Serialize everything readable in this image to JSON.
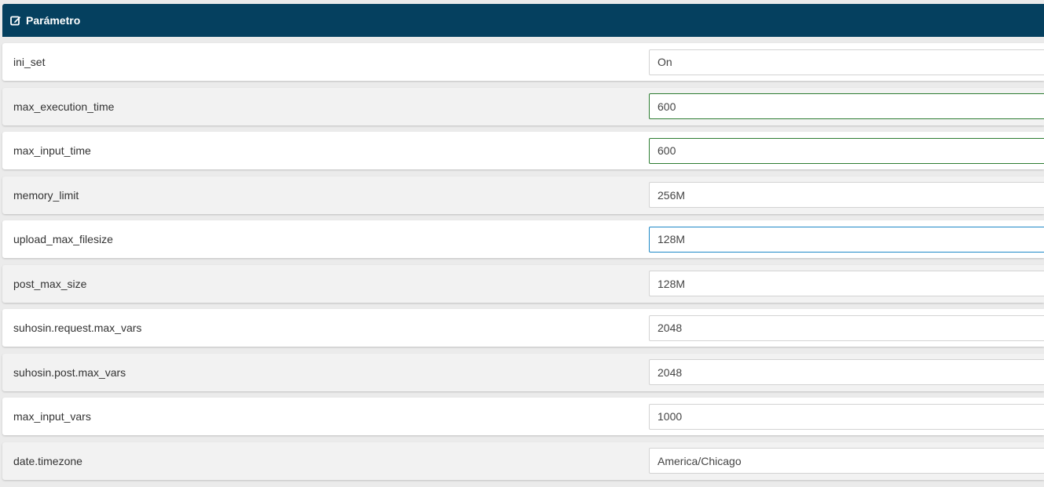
{
  "header": {
    "title": "Parámetro",
    "icon": "edit-icon"
  },
  "rows": [
    {
      "name": "ini_set",
      "value": "On",
      "state": "normal"
    },
    {
      "name": "max_execution_time",
      "value": "600",
      "state": "valid"
    },
    {
      "name": "max_input_time",
      "value": "600",
      "state": "valid"
    },
    {
      "name": "memory_limit",
      "value": "256M",
      "state": "normal"
    },
    {
      "name": "upload_max_filesize",
      "value": "128M",
      "state": "focused"
    },
    {
      "name": "post_max_size",
      "value": "128M",
      "state": "normal"
    },
    {
      "name": "suhosin.request.max_vars",
      "value": "2048",
      "state": "normal"
    },
    {
      "name": "suhosin.post.max_vars",
      "value": "2048",
      "state": "normal"
    },
    {
      "name": "max_input_vars",
      "value": "1000",
      "state": "normal"
    },
    {
      "name": "date.timezone",
      "value": "America/Chicago",
      "state": "normal"
    }
  ],
  "colors": {
    "header_bg": "#05405f",
    "valid_border": "#2e7d32",
    "focus_border": "#1e88c7"
  }
}
